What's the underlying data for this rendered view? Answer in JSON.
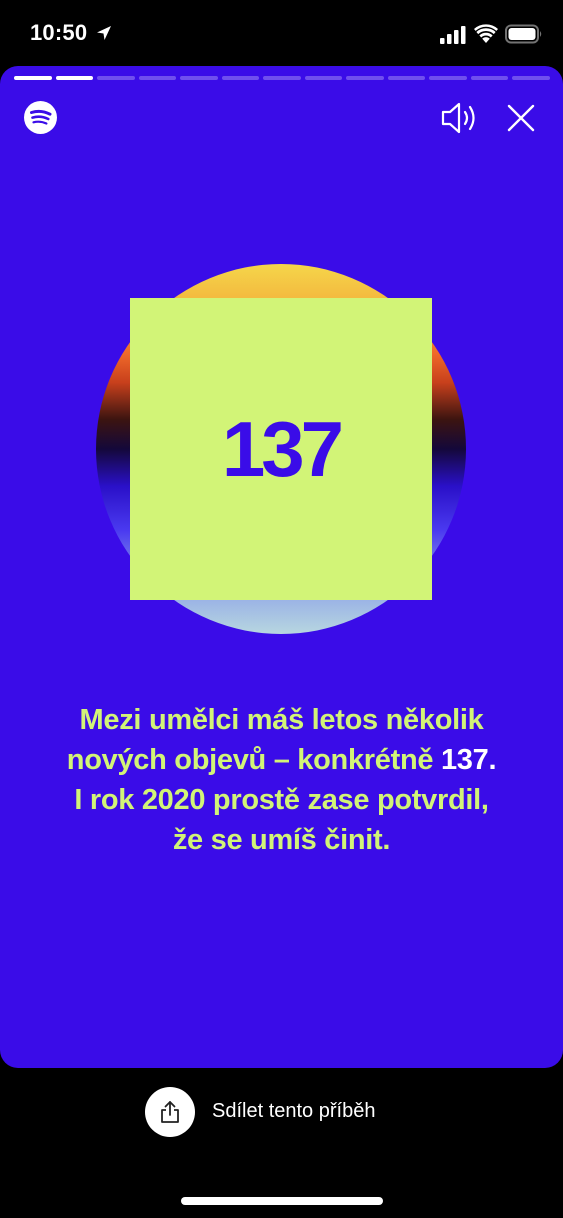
{
  "status_bar": {
    "time": "10:50",
    "icons": [
      "location-arrow-icon",
      "signal-icon",
      "wifi-icon",
      "battery-icon"
    ]
  },
  "story": {
    "progress": {
      "segments": 13,
      "completed": 2
    },
    "logo": "spotify-logo",
    "controls": {
      "sound_icon": "speaker-icon",
      "close_icon": "close-icon"
    },
    "art": {
      "number": "137"
    },
    "message": {
      "line1": "Mezi umělci máš letos několik",
      "line2_prefix": "nových objevů – konkrétně ",
      "line2_highlight": "137.",
      "line3": "I rok 2020 prostě zase potvrdil,",
      "line4": "že se umíš činit."
    },
    "colors": {
      "background": "#3a0ce8",
      "accent": "#d2f477",
      "highlight": "#ffffff"
    }
  },
  "share": {
    "label": "Sdílet tento příběh",
    "icon": "share-icon"
  }
}
